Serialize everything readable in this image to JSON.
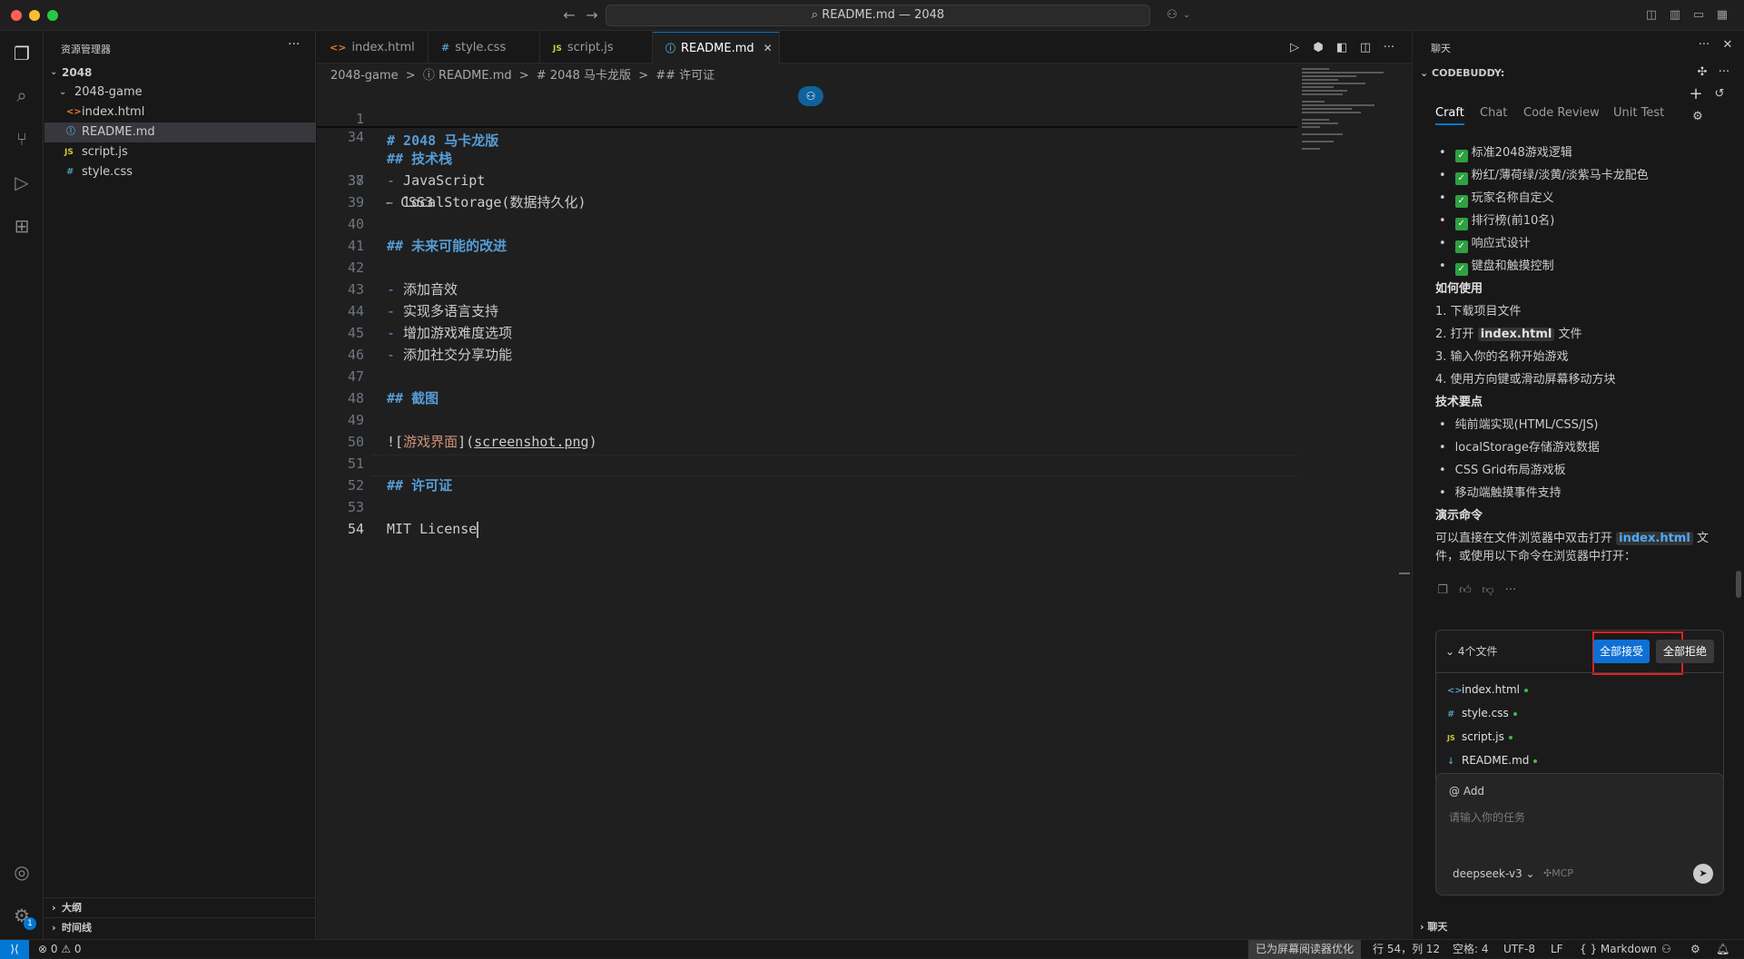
{
  "title_bar": {
    "command_center": "README.md — 2048",
    "back_icon": "arrow-left-icon",
    "forward_icon": "arrow-right-icon"
  },
  "activity_bar": {
    "items": [
      "explorer-icon",
      "search-icon",
      "source-control-icon",
      "run-debug-icon",
      "extensions-icon"
    ],
    "account_icon": "account-icon",
    "settings_icon": "gear-icon",
    "settings_badge": "1"
  },
  "sidebar": {
    "header": "资源管理器",
    "root": "2048",
    "folder": "2048-game",
    "files": [
      {
        "icon": "<>",
        "name": "index.html",
        "color": "#e37933"
      },
      {
        "icon": "ⓘ",
        "name": "README.md",
        "color": "#519aba",
        "selected": true
      },
      {
        "icon": "JS",
        "name": "script.js",
        "color": "#cbcb41"
      },
      {
        "icon": "#",
        "name": "style.css",
        "color": "#519aba"
      }
    ],
    "outline": "大纲",
    "timeline": "时间线"
  },
  "editor": {
    "tabs": [
      {
        "icon": "<>",
        "label": "index.html",
        "color": "#e37933"
      },
      {
        "icon": "#",
        "label": "style.css",
        "color": "#519aba"
      },
      {
        "icon": "JS",
        "label": "script.js",
        "color": "#cbcb41"
      },
      {
        "icon": "ⓘ",
        "label": "README.md",
        "color": "#519aba",
        "active": true
      }
    ],
    "breadcrumb": [
      "2048-game",
      ">",
      "ⓘ README.md",
      ">",
      "# 2048 马卡龙版",
      ">",
      "## 许可证"
    ],
    "sticky": [
      {
        "n": "1",
        "text": "# 2048 马卡龙版"
      },
      {
        "n": "34",
        "text": "## 技术栈"
      }
    ],
    "partial_line": "- CSS3",
    "lines": [
      {
        "n": "38",
        "text": "- JavaScript",
        "kind": "item"
      },
      {
        "n": "39",
        "text": "- localStorage(数据持久化)",
        "kind": "item"
      },
      {
        "n": "40",
        "text": "",
        "kind": "plain"
      },
      {
        "n": "41",
        "text": "## 未来可能的改进",
        "kind": "heading"
      },
      {
        "n": "42",
        "text": "",
        "kind": "plain"
      },
      {
        "n": "43",
        "text": "- 添加音效",
        "kind": "item"
      },
      {
        "n": "44",
        "text": "- 实现多语言支持",
        "kind": "item"
      },
      {
        "n": "45",
        "text": "- 增加游戏难度选项",
        "kind": "item"
      },
      {
        "n": "46",
        "text": "- 添加社交分享功能",
        "kind": "item"
      },
      {
        "n": "47",
        "text": "",
        "kind": "plain"
      },
      {
        "n": "48",
        "text": "## 截图",
        "kind": "heading"
      },
      {
        "n": "49",
        "text": "",
        "kind": "plain"
      },
      {
        "n": "50",
        "text": "![游戏界面](screenshot.png)",
        "kind": "image"
      },
      {
        "n": "51",
        "text": "",
        "kind": "plain"
      },
      {
        "n": "52",
        "text": "## 许可证",
        "kind": "heading"
      },
      {
        "n": "53",
        "text": "",
        "kind": "plain"
      },
      {
        "n": "54",
        "text": "MIT License",
        "kind": "current"
      }
    ]
  },
  "chat": {
    "header": "聊天",
    "section": "CODEBUDDY:",
    "tabs": [
      "Craft",
      "Chat",
      "Code Review",
      "Unit Test"
    ],
    "features": [
      "标准2048游戏逻辑",
      "粉红/薄荷绿/淡黄/淡紫马卡龙配色",
      "玩家名称自定义",
      "排行榜(前10名)",
      "响应式设计",
      "键盘和触摸控制"
    ],
    "how_title": "如何使用",
    "how_1": "1. 下载项目文件",
    "how_2_pre": "2. 打开",
    "how_2_code": "index.html",
    "how_2_post": "文件",
    "how_3": "3. 输入你的名称开始游戏",
    "how_4": "4. 使用方向键或滑动屏幕移动方块",
    "tech_title": "技术要点",
    "tech": [
      "纯前端实现(HTML/CSS/JS)",
      "localStorage存储游戏数据",
      "CSS Grid布局游戏板",
      "移动端触摸事件支持"
    ],
    "demo_title": "演示命令",
    "demo_pre": "可以直接在文件浏览器中双击打开",
    "demo_code": "index.html",
    "demo_post": "文",
    "demo_line2": "件，或使用以下命令在浏览器中打开：",
    "files_count": "4个文件",
    "accept_all": "全部接受",
    "reject_all": "全部拒绝",
    "changed_files": [
      {
        "icon": "<>",
        "name": "index.html",
        "color": "#519aba"
      },
      {
        "icon": "#",
        "name": "style.css",
        "color": "#519aba"
      },
      {
        "icon": "JS",
        "name": "script.js",
        "color": "#cbcb41"
      },
      {
        "icon": "↓",
        "name": "README.md",
        "color": "#519aba"
      }
    ],
    "add_label": "@ Add",
    "task_placeholder": "请输入你的任务",
    "model": "deepseek-v3",
    "mcp": "MCP",
    "bottom": "聊天"
  },
  "status_bar": {
    "problems": "⊗ 0 ⚠ 0",
    "screen_reader": "已为屏幕阅读器优化",
    "position": "行 54，列 12",
    "spaces": "空格: 4",
    "encoding": "UTF-8",
    "eol": "LF",
    "language": "{ } Markdown"
  }
}
